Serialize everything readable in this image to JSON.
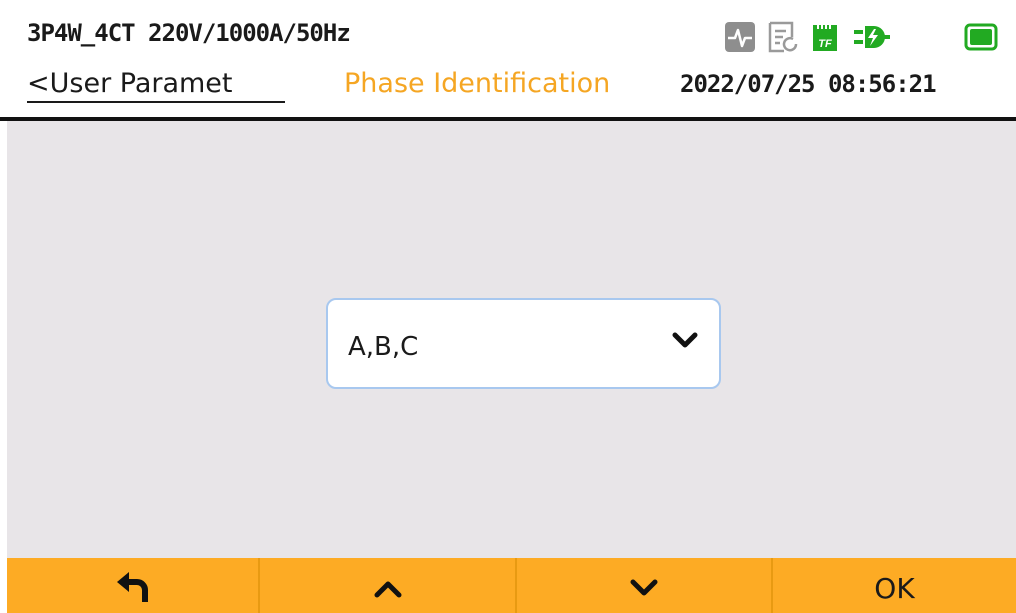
{
  "header": {
    "wiring_info": "3P4W_4CT 220V/1000A/50Hz",
    "back_link": "<User Paramet",
    "page_title": "Phase Identification",
    "datetime": "2022/07/25 08:56:21",
    "status_icons": [
      "waveform-icon",
      "report-icon",
      "tf-card-icon",
      "power-plug-icon",
      "battery-icon"
    ],
    "tf_label": "TF"
  },
  "main": {
    "phase_select": {
      "value": "A,B,C",
      "icon": "chevron-down-icon"
    }
  },
  "toolbar": {
    "buttons": [
      {
        "icon": "back-arrow-icon"
      },
      {
        "icon": "chevron-up-icon"
      },
      {
        "icon": "chevron-down-icon"
      },
      {
        "label": "OK"
      }
    ]
  },
  "colors": {
    "accent": "#fdab24",
    "title": "#f5a623",
    "content_bg": "#e8e5e8",
    "select_border": "#a8c8ef",
    "status_green": "#22aa22"
  }
}
